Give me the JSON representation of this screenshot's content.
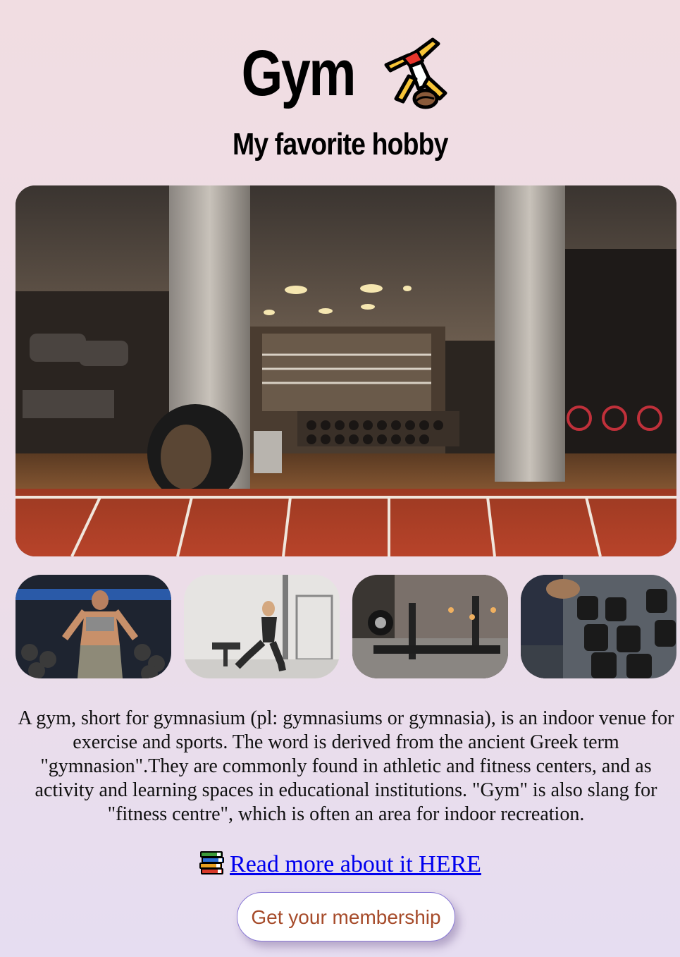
{
  "header": {
    "title": "Gym",
    "title_icon": "person-cartwheeling-icon",
    "subtitle": "My favorite hobby"
  },
  "images": {
    "hero": "gym-interior-with-track-photo",
    "thumbnails": [
      "woman-lifting-dumbbells-photo",
      "woman-lunging-photo",
      "gym-equipment-photo",
      "dumbbell-rack-photo"
    ]
  },
  "content": {
    "description": "A gym, short for gymnasium (pl: gymnasiums or gymnasia), is an indoor venue for exercise and sports. The word is derived from the ancient Greek term \"gymnasion\".They are commonly found in athletic and fitness centers, and as activity and learning spaces in educational institutions. \"Gym\" is also slang for \"fitness centre\", which is often an area for indoor recreation.",
    "read_more_icon": "books-icon",
    "read_more_label": "Read more about it HERE",
    "cta_label": "Get your membership"
  },
  "colors": {
    "background_top": "#f1dde2",
    "background_bottom": "#e6ddf1",
    "link": "#0000ee",
    "cta_text": "#a64b2a",
    "cta_border": "#8a7ad6"
  }
}
